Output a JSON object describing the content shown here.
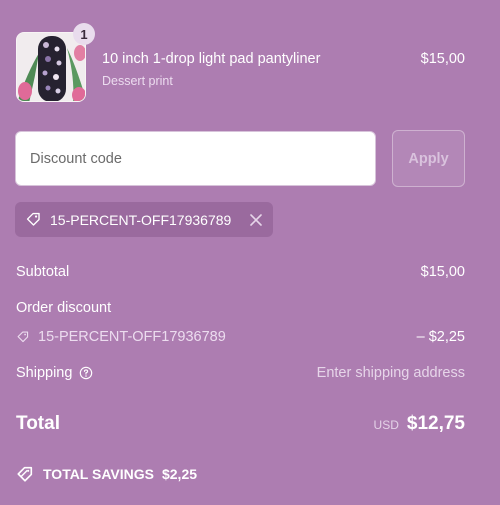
{
  "product": {
    "name": "10 inch 1-drop light pad pantyliner",
    "variant": "Dessert print",
    "price": "$15,00",
    "quantity": "1"
  },
  "discount": {
    "placeholder": "Discount code",
    "apply_label": "Apply",
    "applied_code": "15-PERCENT-OFF17936789"
  },
  "summary": {
    "subtotal_label": "Subtotal",
    "subtotal_value": "$15,00",
    "order_discount_label": "Order discount",
    "order_discount_code": "15-PERCENT-OFF17936789",
    "order_discount_value": "– $2,25",
    "shipping_label": "Shipping",
    "shipping_value": "Enter shipping address",
    "total_label": "Total",
    "total_currency": "USD",
    "total_value": "$12,75",
    "savings_label": "TOTAL SAVINGS",
    "savings_value": "$2,25"
  },
  "icons": {
    "tag": "tag-icon",
    "remove": "close-icon",
    "help": "question-circle-icon",
    "savings": "tag-icon"
  },
  "colors": {
    "background": "#ad7db1",
    "chip": "#9a6a9e"
  }
}
